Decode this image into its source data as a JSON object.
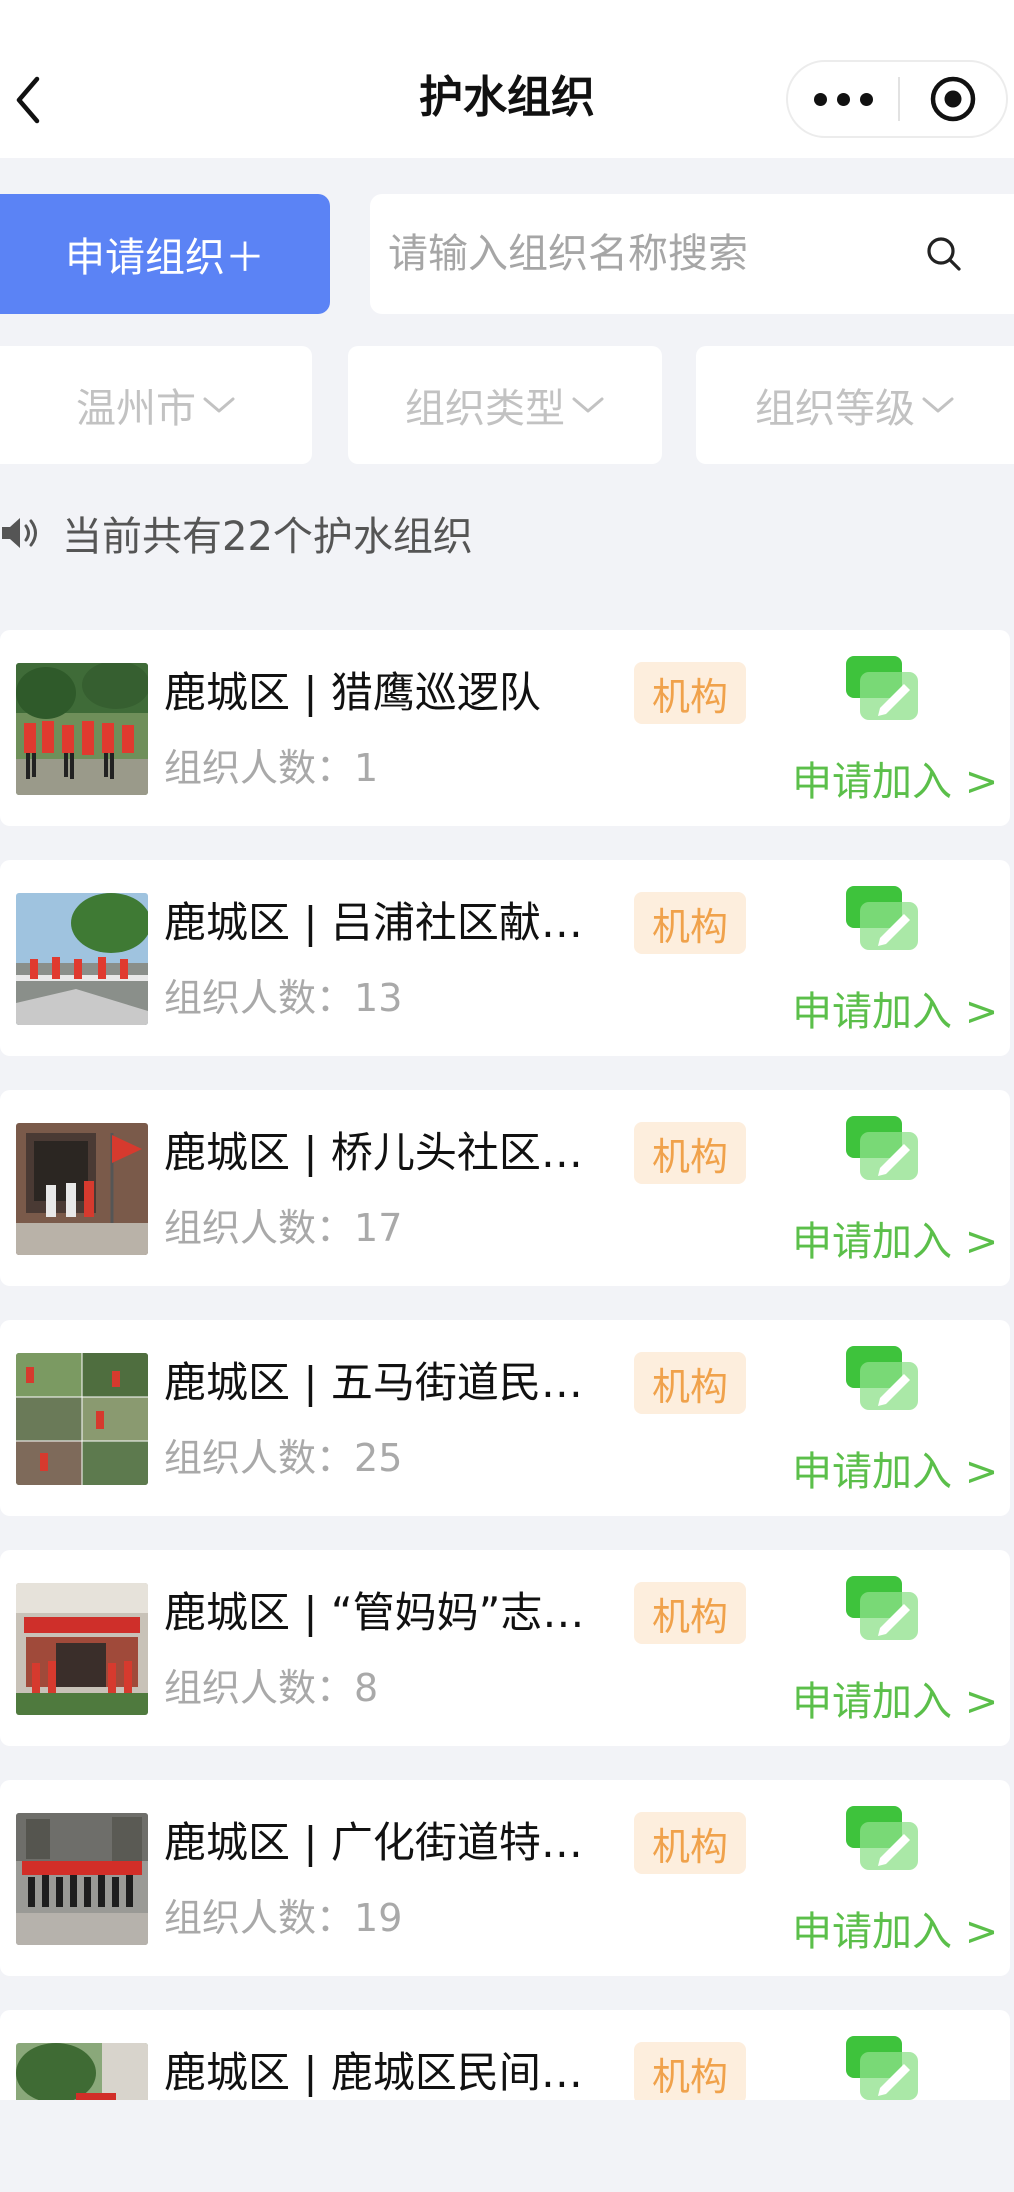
{
  "header": {
    "title": "护水组织",
    "back_icon": "chevron-left-icon",
    "more_icon": "more-dots-icon",
    "close_icon": "target-close-icon"
  },
  "toolbar": {
    "apply_label": "申请组织＋",
    "search_placeholder": "请输入组织名称搜索",
    "search_value": ""
  },
  "filters": [
    {
      "label": "温州市"
    },
    {
      "label": "组织类型"
    },
    {
      "label": "组织等级"
    }
  ],
  "notice": {
    "text": "当前共有22个护水组织",
    "icon": "speaker-icon"
  },
  "colors": {
    "primary": "#5b83f5",
    "join_green": "#5bbf4a",
    "tag_bg": "#fdeedd",
    "tag_text": "#f0a24b",
    "page_bg": "#f2f3f7"
  },
  "organizations": [
    {
      "name": "鹿城区 | 猎鹰巡逻队",
      "tag": "机构",
      "member_label": "组织人数：",
      "members": "1",
      "join_label": "申请加入 >"
    },
    {
      "name": "鹿城区 | 吕浦社区献…",
      "tag": "机构",
      "member_label": "组织人数：",
      "members": "13",
      "join_label": "申请加入 >"
    },
    {
      "name": "鹿城区 | 桥儿头社区…",
      "tag": "机构",
      "member_label": "组织人数：",
      "members": "17",
      "join_label": "申请加入 >"
    },
    {
      "name": "鹿城区 | 五马街道民…",
      "tag": "机构",
      "member_label": "组织人数：",
      "members": "25",
      "join_label": "申请加入 >"
    },
    {
      "name": "鹿城区 | “管妈妈”志…",
      "tag": "机构",
      "member_label": "组织人数：",
      "members": "8",
      "join_label": "申请加入 >"
    },
    {
      "name": "鹿城区 | 广化街道特…",
      "tag": "机构",
      "member_label": "组织人数：",
      "members": "19",
      "join_label": "申请加入 >"
    },
    {
      "name": "鹿城区 | 鹿城区民间…",
      "tag": "机构",
      "member_label": "",
      "members": "",
      "join_label": ""
    }
  ]
}
